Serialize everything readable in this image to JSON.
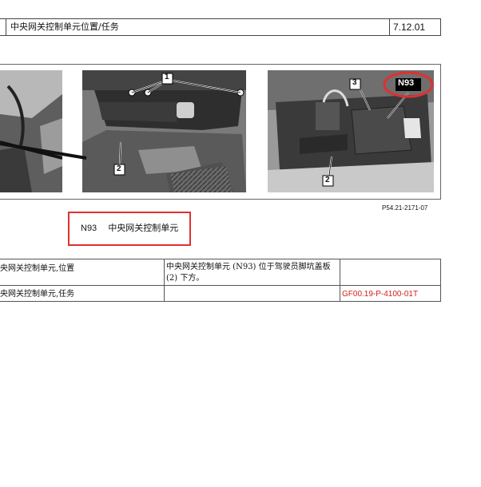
{
  "header": {
    "title": "中央网关控制单元位置/任务",
    "code": "7.12.01"
  },
  "figure": {
    "callouts": {
      "one": "1",
      "two_a": "2",
      "three": "3",
      "two_b": "2",
      "n93": "N93"
    },
    "figure_id": "P54.21-2171-07",
    "legend": {
      "code": "N93",
      "label": "中央网关控制单元"
    }
  },
  "table": {
    "rows": [
      {
        "name": "央网关控制单元,位置",
        "desc_line1": "中央网关控制单元 (N93) 位于驾驶员脚坑盖板",
        "desc_line2": "(2) 下方。",
        "ref": ""
      },
      {
        "name": "央网关控制单元,任务",
        "desc_line1": "",
        "desc_line2": "",
        "ref": "GF00.19-P-4100-01T"
      }
    ]
  },
  "colors": {
    "highlight": "#e03030",
    "link_red": "#d0211c"
  }
}
